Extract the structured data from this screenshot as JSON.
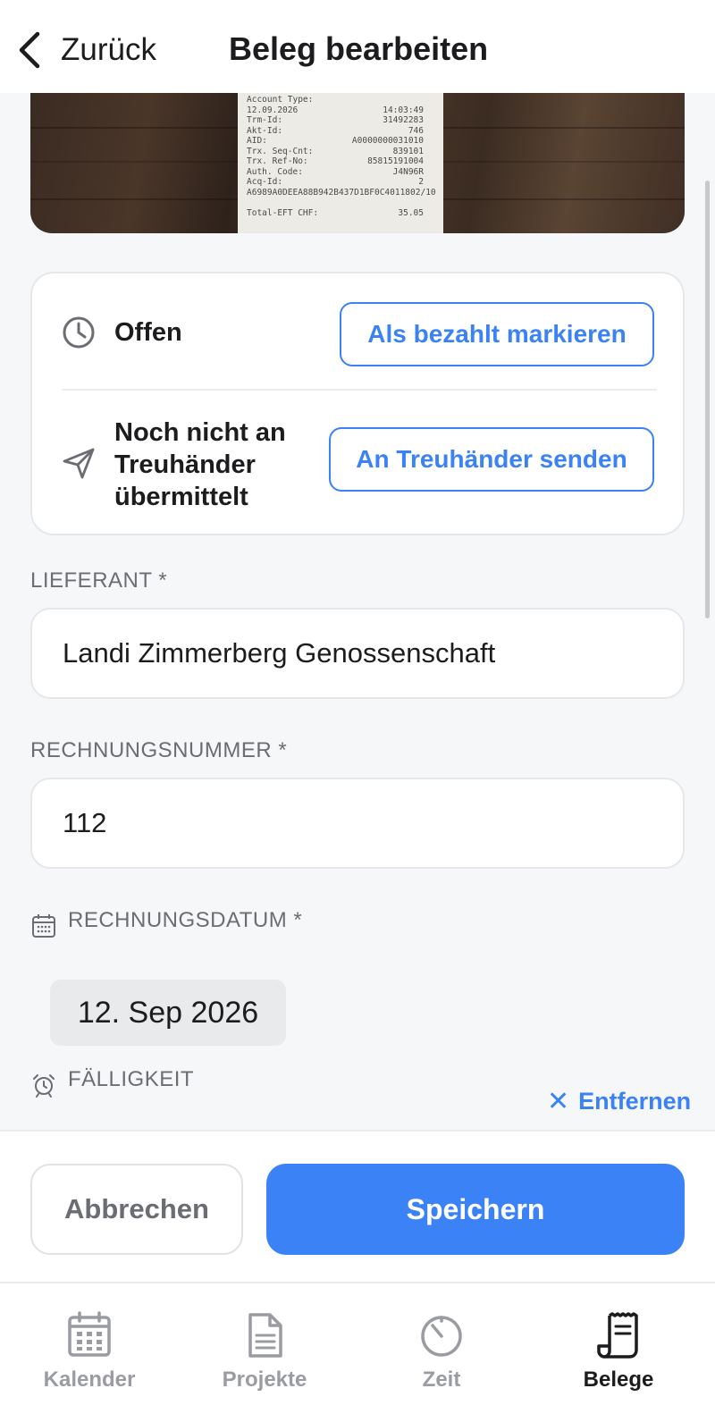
{
  "header": {
    "back_label": "Zurück",
    "title": "Beleg bearbeiten"
  },
  "receipt": {
    "lines": [
      [
        "Account Type:",
        ""
      ],
      [
        "12.09.2026",
        "14:03:49"
      ],
      [
        "Trm-Id:",
        "31492283"
      ],
      [
        "Akt-Id:",
        "746"
      ],
      [
        "AID:",
        "A0000000031010"
      ],
      [
        "Trx. Seq-Cnt:",
        "839101"
      ],
      [
        "Trx. Ref-No:",
        "85815191004"
      ],
      [
        "Auth. Code:",
        "J4N96R"
      ],
      [
        "Acq-Id:",
        "2"
      ],
      [
        "A6989A0DEEA88B942B437D1BF0C40118",
        "02/10"
      ],
      [
        "",
        ""
      ],
      [
        "Total-EFT CHF:",
        "35.05"
      ]
    ]
  },
  "status": {
    "payment_label": "Offen",
    "payment_button": "Als bezahlt markieren",
    "transfer_label": "Noch nicht an Treuhänder übermittelt",
    "transfer_button": "An Treuhänder senden"
  },
  "form": {
    "supplier_label": "LIEFERANT *",
    "supplier_value": "Landi Zimmerberg Genossenschaft",
    "invoice_number_label": "RECHNUNGSNUMMER *",
    "invoice_number_value": "112",
    "invoice_date_label": "RECHNUNGSDATUM *",
    "invoice_date_value": "12. Sep 2026",
    "due_label": "FÄLLIGKEIT",
    "remove_label": "Entfernen"
  },
  "actions": {
    "cancel_label": "Abbrechen",
    "save_label": "Speichern"
  },
  "tabs": [
    {
      "label": "Kalender",
      "icon": "calendar-icon",
      "active": false
    },
    {
      "label": "Projekte",
      "icon": "document-icon",
      "active": false
    },
    {
      "label": "Zeit",
      "icon": "timer-icon",
      "active": false
    },
    {
      "label": "Belege",
      "icon": "receipt-icon",
      "active": true
    }
  ],
  "colors": {
    "accent": "#3b82f6",
    "background": "#f6f7f9",
    "muted_text": "#6b6d73",
    "inactive_tab": "#9a9ca2"
  }
}
